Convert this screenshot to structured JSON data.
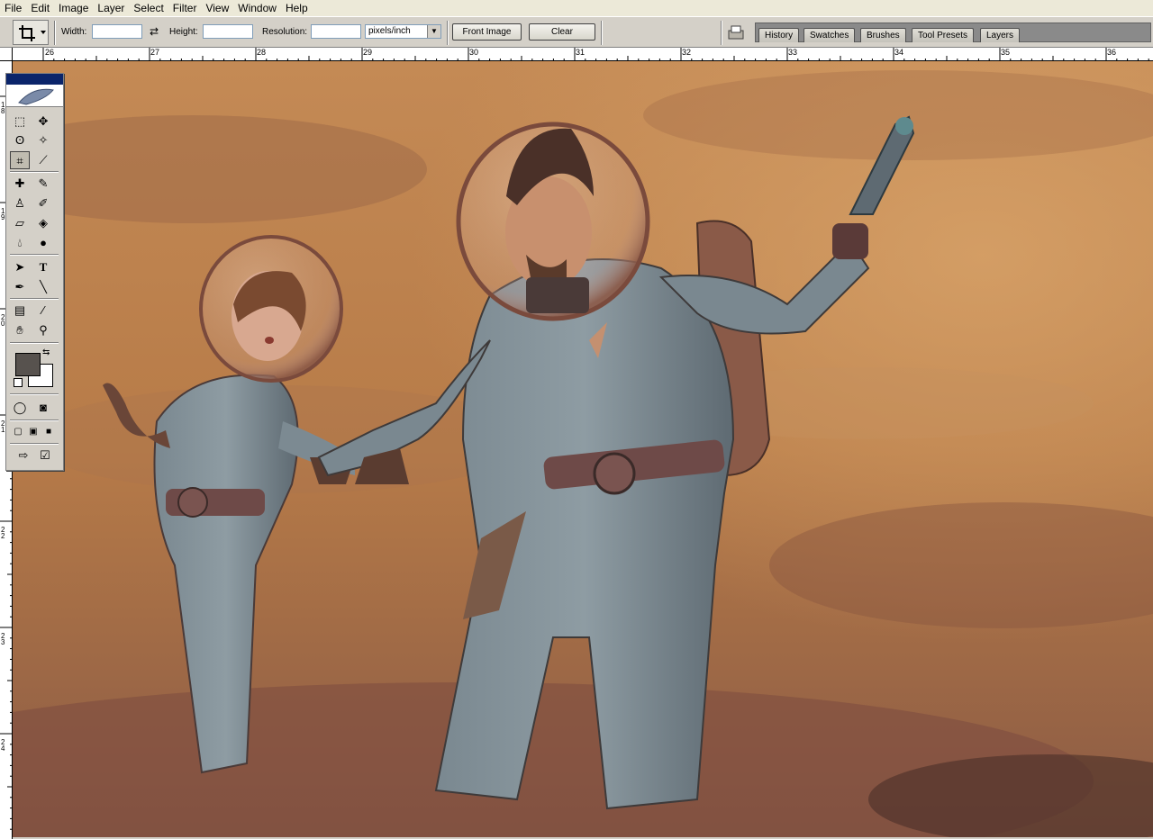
{
  "menu": [
    "File",
    "Edit",
    "Image",
    "Layer",
    "Select",
    "Filter",
    "View",
    "Window",
    "Help"
  ],
  "options": {
    "width_label": "Width:",
    "height_label": "Height:",
    "resolution_label": "Resolution:",
    "resolution_unit": "pixels/inch",
    "front_image": "Front Image",
    "clear": "Clear"
  },
  "palette_well": [
    "History",
    "Swatches",
    "Brushes",
    "Tool Presets",
    "Layers"
  ],
  "ruler_top": [
    "26",
    "27",
    "28",
    "29",
    "30",
    "31",
    "32",
    "33",
    "34",
    "35",
    "36"
  ],
  "ruler_left": [
    "18",
    "19",
    "20",
    "21",
    "22",
    "23",
    "24"
  ],
  "colors": {
    "foreground": "#57524e",
    "background": "#ffffff",
    "accent": "#0a246a"
  },
  "toolbox_icons": [
    "marquee-icon",
    "move-icon",
    "lasso-icon",
    "magic-wand-icon",
    "crop-icon",
    "slice-icon",
    "healing-brush-icon",
    "brush-icon",
    "clone-stamp-icon",
    "history-brush-icon",
    "eraser-icon",
    "paint-bucket-icon",
    "blur-icon",
    "dodge-icon",
    "path-selection-icon",
    "type-icon",
    "pen-icon",
    "line-icon",
    "notes-icon",
    "eyedropper-icon",
    "hand-icon",
    "zoom-icon"
  ]
}
